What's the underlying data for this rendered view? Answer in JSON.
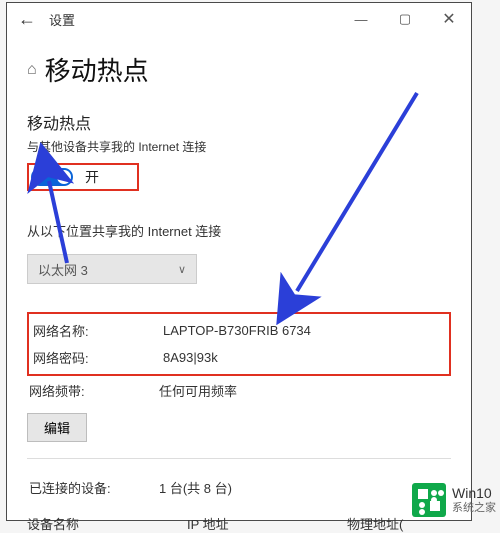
{
  "titlebar": {
    "back_glyph": "←",
    "title": "设置",
    "min_glyph": "—",
    "max_glyph": "▢",
    "close_glyph": "✕"
  },
  "header": {
    "home_glyph": "⌂",
    "page_title": "移动热点"
  },
  "hotspot": {
    "section_title": "移动热点",
    "subtitle": "与其他设备共享我的 Internet 连接",
    "toggle_state": "开"
  },
  "share_from": {
    "section_title": "从以下位置共享我的 Internet 连接",
    "selected": "以太网 3",
    "chev": "∨"
  },
  "network": {
    "name_key": "网络名称:",
    "name_val": "LAPTOP-B730FRIB 6734",
    "pwd_key": "网络密码:",
    "pwd_val": "8A93|93k",
    "band_key": "网络频带:",
    "band_val": "任何可用频率",
    "edit_label": "编辑"
  },
  "devices": {
    "connected_key": "已连接的设备:",
    "connected_val": "1 台(共 8 台)",
    "col_name": "设备名称",
    "col_ip": "IP 地址",
    "col_mac": "物理地址("
  },
  "watermark": {
    "line1": "Win10",
    "line2": "系统之家"
  }
}
